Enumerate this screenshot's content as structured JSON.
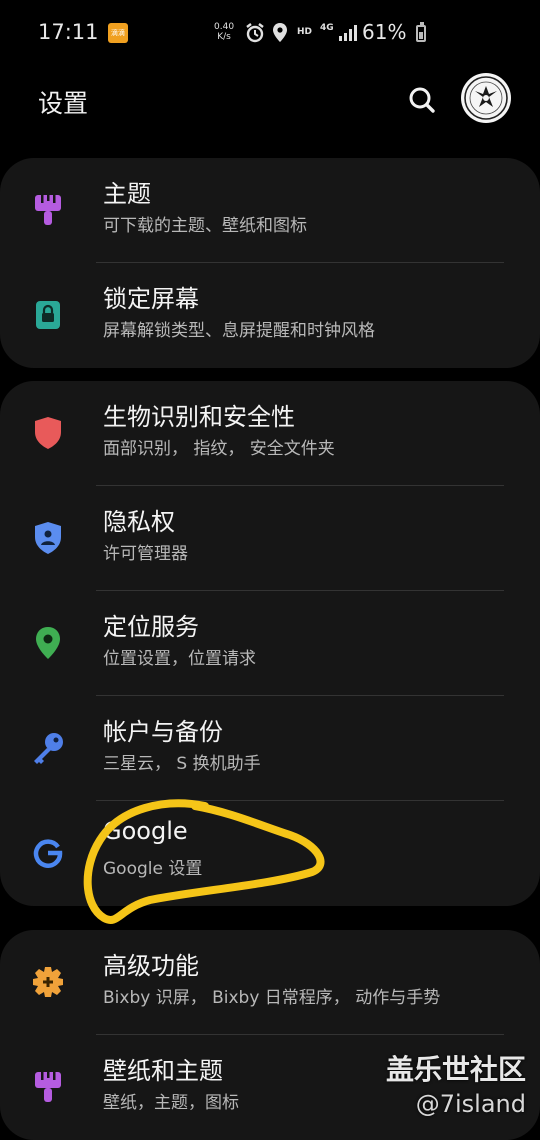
{
  "status_bar": {
    "time": "17:11",
    "badge_text": "滴滴",
    "net_speed_value": "0.40",
    "net_speed_unit": "K/s",
    "hd_label": "HD",
    "network_type": "4G",
    "battery_percent": "61%",
    "battery_level": 0.61
  },
  "header": {
    "title": "设置"
  },
  "groups": [
    {
      "items": [
        {
          "title": "主题",
          "subtitle": "可下载的主题、壁纸和图标",
          "icon": "theme-brush-icon",
          "icon_color": "#b55ce0"
        },
        {
          "title": "锁定屏幕",
          "subtitle": "屏幕解锁类型、息屏提醒和时钟风格",
          "icon": "lock-icon",
          "icon_color": "#2aa897"
        }
      ]
    },
    {
      "items": [
        {
          "title": "生物识别和安全性",
          "subtitle": "面部识别， 指纹， 安全文件夹",
          "icon": "shield-icon",
          "icon_color": "#e85a5a"
        },
        {
          "title": "隐私权",
          "subtitle": "许可管理器",
          "icon": "privacy-shield-icon",
          "icon_color": "#5b8def"
        },
        {
          "title": "定位服务",
          "subtitle": "位置设置，位置请求",
          "icon": "location-pin-icon",
          "icon_color": "#3fae52"
        },
        {
          "title": "帐户与备份",
          "subtitle": "三星云， S 换机助手",
          "icon": "key-icon",
          "icon_color": "#4f7fe8"
        },
        {
          "title": "Google",
          "subtitle": "Google 设置",
          "icon": "google-g-icon",
          "icon_color": "#4a86f0"
        }
      ]
    },
    {
      "items": [
        {
          "title": "高级功能",
          "subtitle": "Bixby 识屏， Bixby 日常程序， 动作与手势",
          "icon": "gear-plus-icon",
          "icon_color": "#f0a23a"
        },
        {
          "title": "壁纸和主题",
          "subtitle": "壁纸，主题，图标",
          "icon": "theme-brush-icon",
          "icon_color": "#b55ce0"
        }
      ]
    }
  ],
  "annotation": {
    "color": "#f5c518"
  },
  "watermark": {
    "title": "盖乐世社区",
    "handle": "@7island"
  }
}
